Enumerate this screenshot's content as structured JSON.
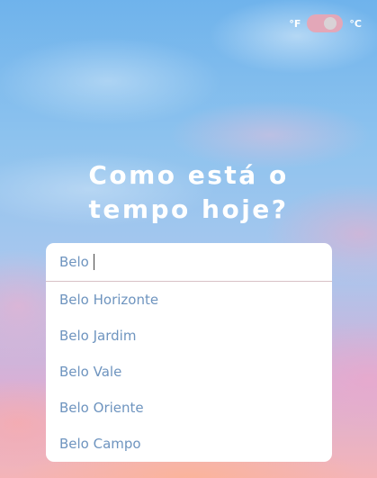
{
  "unit_toggle": {
    "fahrenheit_label": "°F",
    "celsius_label": "°C",
    "selected": "°C"
  },
  "heading": {
    "line1": "Como está o",
    "line2": "tempo hoje?"
  },
  "search": {
    "value": "Belo",
    "suggestions": [
      "Belo Horizonte",
      "Belo Jardim",
      "Belo Vale",
      "Belo Oriente",
      "Belo Campo"
    ]
  },
  "colors": {
    "accent_text": "#6e94bf",
    "toggle_track": "#e3a7b8"
  }
}
